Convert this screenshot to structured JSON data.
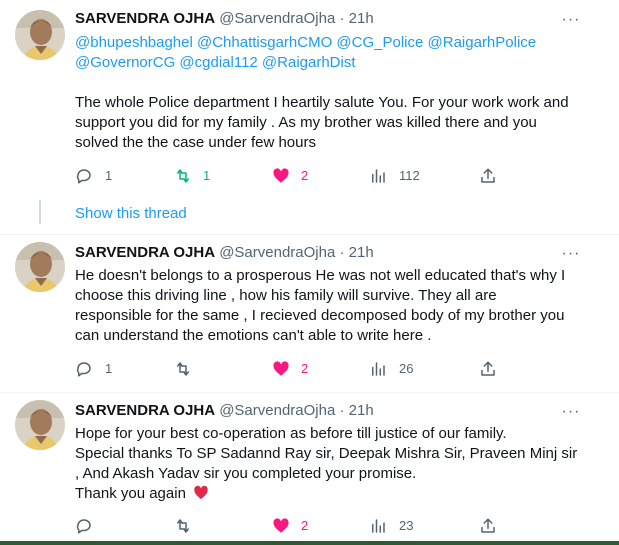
{
  "tweets": [
    {
      "name": "SARVENDRA OJHA",
      "handle": "@SarvendraOjha",
      "sep": "·",
      "time": "21h",
      "mentions_line1": "@bhupeshbaghel @ChhattisgarhCMO @CG_Police @RaigarhPolice",
      "mentions_line2": "@GovernorCG @cgdial112 @RaigarhDist",
      "body": [
        "The whole Police department I heartily salute You. For your work work and",
        "support you did for my family . As my brother was killed there and you",
        "solved the the case under few hours"
      ],
      "replies": "1",
      "retweets": "1",
      "likes": "2",
      "views": "112"
    },
    {
      "name": "SARVENDRA OJHA",
      "handle": "@SarvendraOjha",
      "sep": "·",
      "time": "21h",
      "body": [
        "He doesn't belongs to a prosperous He was not well educated that's why I",
        "choose this driving line , how his family will survive. They all are",
        "responsible for the same , I recieved decomposed body of my brother you",
        "can understand the emotions can't able to write here ."
      ],
      "replies": "1",
      "retweets": "",
      "likes": "2",
      "views": "26"
    },
    {
      "name": "SARVENDRA OJHA",
      "handle": "@SarvendraOjha",
      "sep": "·",
      "time": "21h",
      "body": [
        "Hope for your best co-operation as before till justice of our family.",
        "Special thanks To SP Sadannd Ray sir, Deepak Mishra Sir, Praveen Minj sir",
        ", And Akash Yadav sir you completed your promise.",
        "Thank you again"
      ],
      "replies": "",
      "retweets": "",
      "likes": "2",
      "views": "23"
    }
  ],
  "show_thread_label": "Show this thread",
  "more_glyph": "···",
  "colors": {
    "accent": "#1d9bf0",
    "retweet_active": "#00ba7c",
    "like_active": "#f91880",
    "muted": "#536471"
  },
  "icons": [
    "reply-icon",
    "retweet-icon",
    "like-icon",
    "views-icon",
    "share-icon",
    "more-icon",
    "heart-emoji"
  ]
}
